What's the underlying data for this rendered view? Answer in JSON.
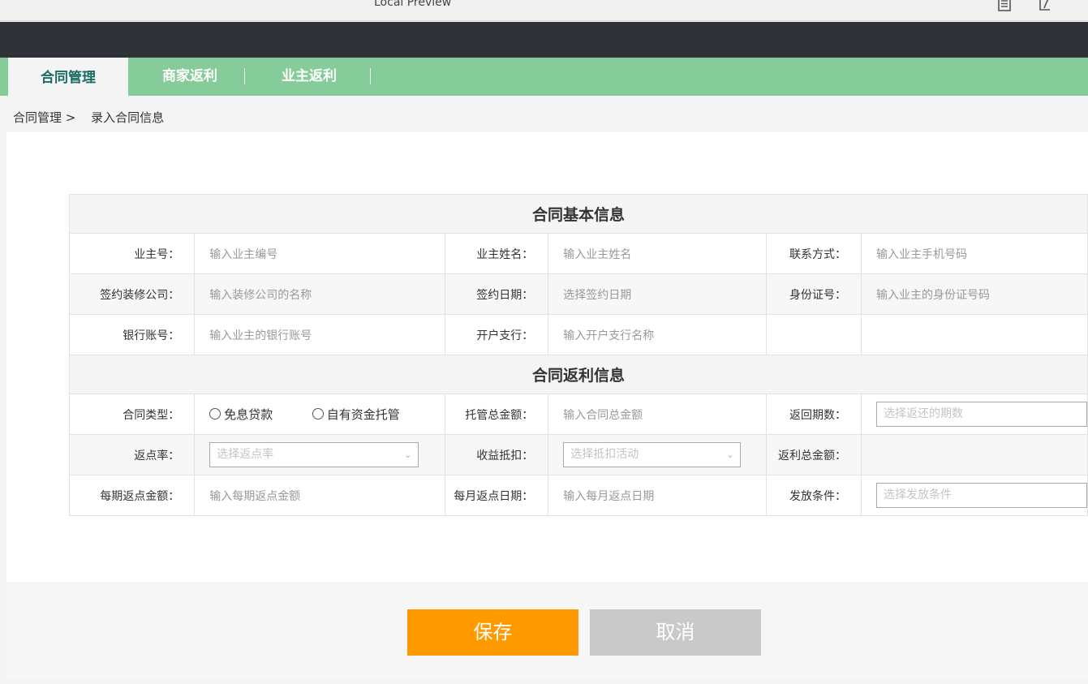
{
  "window": {
    "title": "Local Preview",
    "icons": [
      "document-icon",
      "pdf-icon"
    ]
  },
  "nav": {
    "tabs": [
      {
        "label": "合同管理",
        "active": true
      },
      {
        "label": "商家返利",
        "active": false
      },
      {
        "label": "业主返利",
        "active": false
      }
    ],
    "separator": "|"
  },
  "breadcrumb": {
    "parent": "合同管理 >",
    "current": "录入合同信息"
  },
  "basic": {
    "header": "合同基本信息",
    "owner_no": {
      "label": "业主号：",
      "placeholder": "输入业主编号"
    },
    "owner_name": {
      "label": "业主姓名：",
      "placeholder": "输入业主姓名"
    },
    "contact": {
      "label": "联系方式：",
      "placeholder": "输入业主手机号码"
    },
    "company": {
      "label": "签约装修公司：",
      "placeholder": "输入装修公司的名称"
    },
    "sign_date": {
      "label": "签约日期：",
      "placeholder": "选择签约日期"
    },
    "id_no": {
      "label": "身份证号：",
      "placeholder": "输入业主的身份证号码"
    },
    "bank_account": {
      "label": "银行账号：",
      "placeholder": "输入业主的银行账号"
    },
    "bank_branch": {
      "label": "开户支行：",
      "placeholder": "输入开户支行名称"
    }
  },
  "rebate": {
    "header": "合同返利信息",
    "contract_type": {
      "label": "合同类型：",
      "options": [
        "免息贷款",
        "自有资金托管"
      ]
    },
    "trust_amount": {
      "label": "托管总金额：",
      "placeholder": "输入合同总金额"
    },
    "periods": {
      "label": "返回期数：",
      "placeholder": "选择返还的期数"
    },
    "rate": {
      "label": "返点率：",
      "placeholder": "选择返点率"
    },
    "deduction": {
      "label": "收益抵扣：",
      "placeholder": "选择抵扣活动"
    },
    "total": {
      "label": "返利总金额：",
      "value": ""
    },
    "per_amount": {
      "label": "每期返点金额：",
      "placeholder": "输入每期返点金额"
    },
    "monthly_date": {
      "label": "每月返点日期：",
      "placeholder": "输入每月返点日期"
    },
    "condition": {
      "label": "发放条件：",
      "placeholder": "选择发放条件"
    }
  },
  "actions": {
    "save": "保存",
    "cancel": "取消"
  },
  "colors": {
    "nav": "#86cb9a",
    "active_tab_text": "#1a6b64",
    "save": "#ff9900",
    "cancel": "#c9c9c9",
    "dark_bar": "#2f3338"
  }
}
